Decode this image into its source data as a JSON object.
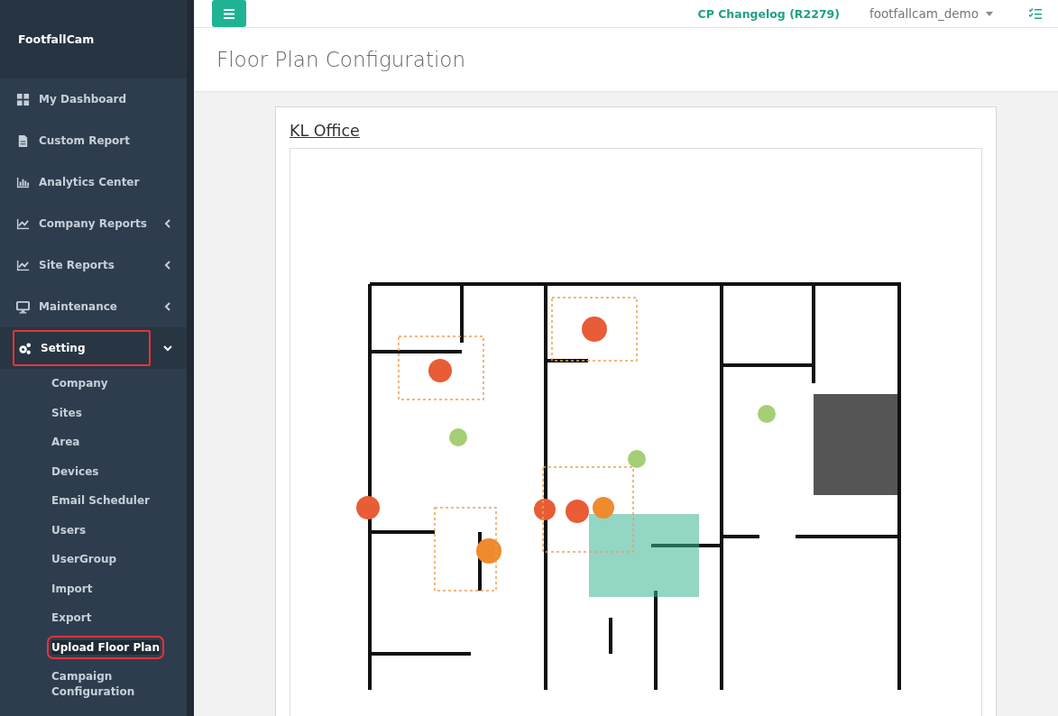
{
  "sidebar": {
    "brand": "FootfallCam",
    "items": [
      {
        "label": "My Dashboard",
        "has_submenu": false,
        "expanded": false,
        "highlighted": false
      },
      {
        "label": "Custom Report",
        "has_submenu": false,
        "expanded": false,
        "highlighted": false
      },
      {
        "label": "Analytics Center",
        "has_submenu": false,
        "expanded": false,
        "highlighted": false
      },
      {
        "label": "Company Reports",
        "has_submenu": true,
        "expanded": false,
        "highlighted": false
      },
      {
        "label": "Site Reports",
        "has_submenu": true,
        "expanded": false,
        "highlighted": false
      },
      {
        "label": "Maintenance",
        "has_submenu": true,
        "expanded": false,
        "highlighted": false
      },
      {
        "label": "Setting",
        "has_submenu": true,
        "expanded": true,
        "highlighted": true,
        "children": [
          {
            "label": "Company",
            "selected": false,
            "highlighted": false
          },
          {
            "label": "Sites",
            "selected": false,
            "highlighted": false
          },
          {
            "label": "Area",
            "selected": false,
            "highlighted": false
          },
          {
            "label": "Devices",
            "selected": false,
            "highlighted": false
          },
          {
            "label": "Email Scheduler",
            "selected": false,
            "highlighted": false
          },
          {
            "label": "Users",
            "selected": false,
            "highlighted": false
          },
          {
            "label": "UserGroup",
            "selected": false,
            "highlighted": false
          },
          {
            "label": "Import",
            "selected": false,
            "highlighted": false
          },
          {
            "label": "Export",
            "selected": false,
            "highlighted": false
          },
          {
            "label": "Upload Floor Plan",
            "selected": true,
            "highlighted": true
          },
          {
            "label": "Campaign Configuration",
            "selected": false,
            "highlighted": false
          }
        ]
      }
    ]
  },
  "topbar": {
    "changelog": "CP Changelog (R2279)",
    "user": "footfallcam_demo"
  },
  "page": {
    "title": "Floor Plan Configuration",
    "card_title": "KL Office"
  }
}
